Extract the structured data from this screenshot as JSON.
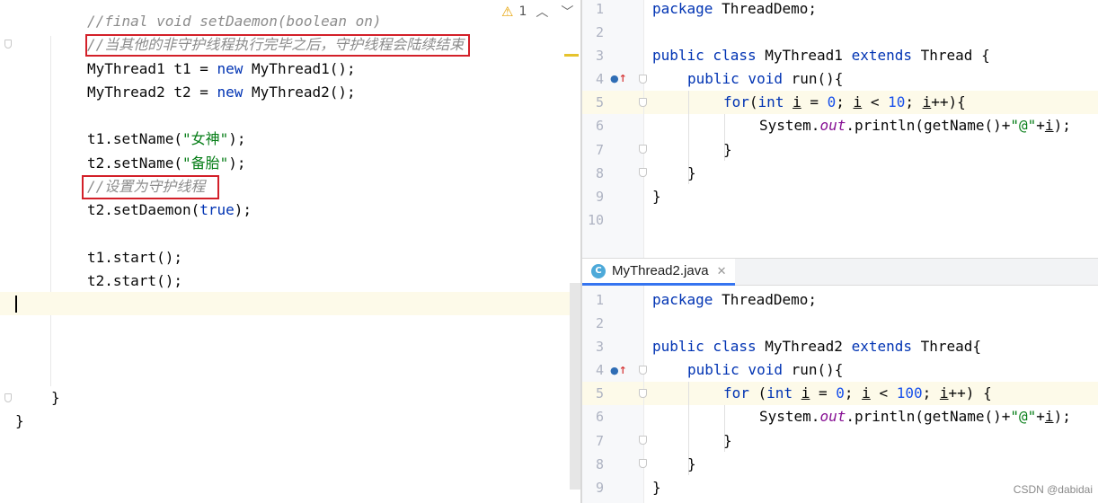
{
  "left_editor": {
    "lines": {
      "l1": "//final void setDaemon(boolean on)",
      "l2": "//当其他的非守护线程执行完毕之后，守护线程会陆续结束",
      "l3a": "MyThread1 t1 = ",
      "l3b": "new",
      "l3c": " MyThread1();",
      "l4a": "MyThread2 t2 = ",
      "l4b": "new",
      "l4c": " MyThread2();",
      "l6a": "t1.setName(",
      "l6b": "\"女神\"",
      "l6c": ");",
      "l7a": "t2.setName(",
      "l7b": "\"备胎\"",
      "l7c": ");",
      "l8": "//设置为守护线程",
      "l9a": "t2.setDaemon(",
      "l9b": "true",
      "l9c": ");",
      "l11": "t1.start();",
      "l12": "t2.start();",
      "close1": "}",
      "close2": "}"
    },
    "inspection": {
      "warning_count": "1"
    }
  },
  "top_editor": {
    "line_numbers": [
      "1",
      "2",
      "3",
      "4",
      "5",
      "6",
      "7",
      "8",
      "9",
      "10"
    ],
    "code": {
      "c1a": "package",
      "c1b": " ThreadDemo;",
      "c3a": "public class",
      "c3b": " MyThread1 ",
      "c3c": "extends",
      "c3d": " Thread {",
      "c4a": "public void",
      "c4b": " run(){",
      "c5a": "for",
      "c5b": "(",
      "c5c": "int",
      "c5d": " ",
      "c5e": "i",
      "c5f": " = ",
      "c5g": "0",
      "c5h": "; ",
      "c5i": "i",
      "c5j": " < ",
      "c5k": "10",
      "c5l": "; ",
      "c5m": "i",
      "c5n": "++){",
      "c6a": "System.",
      "c6b": "out",
      "c6c": ".println(getName()+",
      "c6d": "\"@\"",
      "c6e": "+",
      "c6f": "i",
      "c6g": ");",
      "c7": "}",
      "c8": "}",
      "c9": "}"
    }
  },
  "bottom_editor": {
    "tab": {
      "label": "MyThread2.java",
      "icon_letter": "C"
    },
    "line_numbers": [
      "1",
      "2",
      "3",
      "4",
      "5",
      "6",
      "7",
      "8",
      "9"
    ],
    "code": {
      "c1a": "package",
      "c1b": " ThreadDemo;",
      "c3a": "public class",
      "c3b": " MyThread2 ",
      "c3c": "extends",
      "c3d": " Thread{",
      "c4a": "public void",
      "c4b": " run(){",
      "c5a": "for",
      "c5b": " (",
      "c5c": "int",
      "c5d": " ",
      "c5e": "i",
      "c5f": " = ",
      "c5g": "0",
      "c5h": "; ",
      "c5i": "i",
      "c5j": " < ",
      "c5k": "100",
      "c5l": "; ",
      "c5m": "i",
      "c5n": "++) {",
      "c6a": "System.",
      "c6b": "out",
      "c6c": ".println(getName()+",
      "c6d": "\"@\"",
      "c6e": "+",
      "c6f": "i",
      "c6g": ");",
      "c7": "}",
      "c8": "}",
      "c9": "}"
    }
  },
  "watermark": "CSDN @dabidai",
  "colors": {
    "keyword": "#0033b3",
    "string": "#067d17",
    "comment": "#8c8c8c",
    "field": "#871094",
    "number": "#1750eb",
    "annotation_box": "#d32029",
    "caret_line": "#fdfae9"
  }
}
